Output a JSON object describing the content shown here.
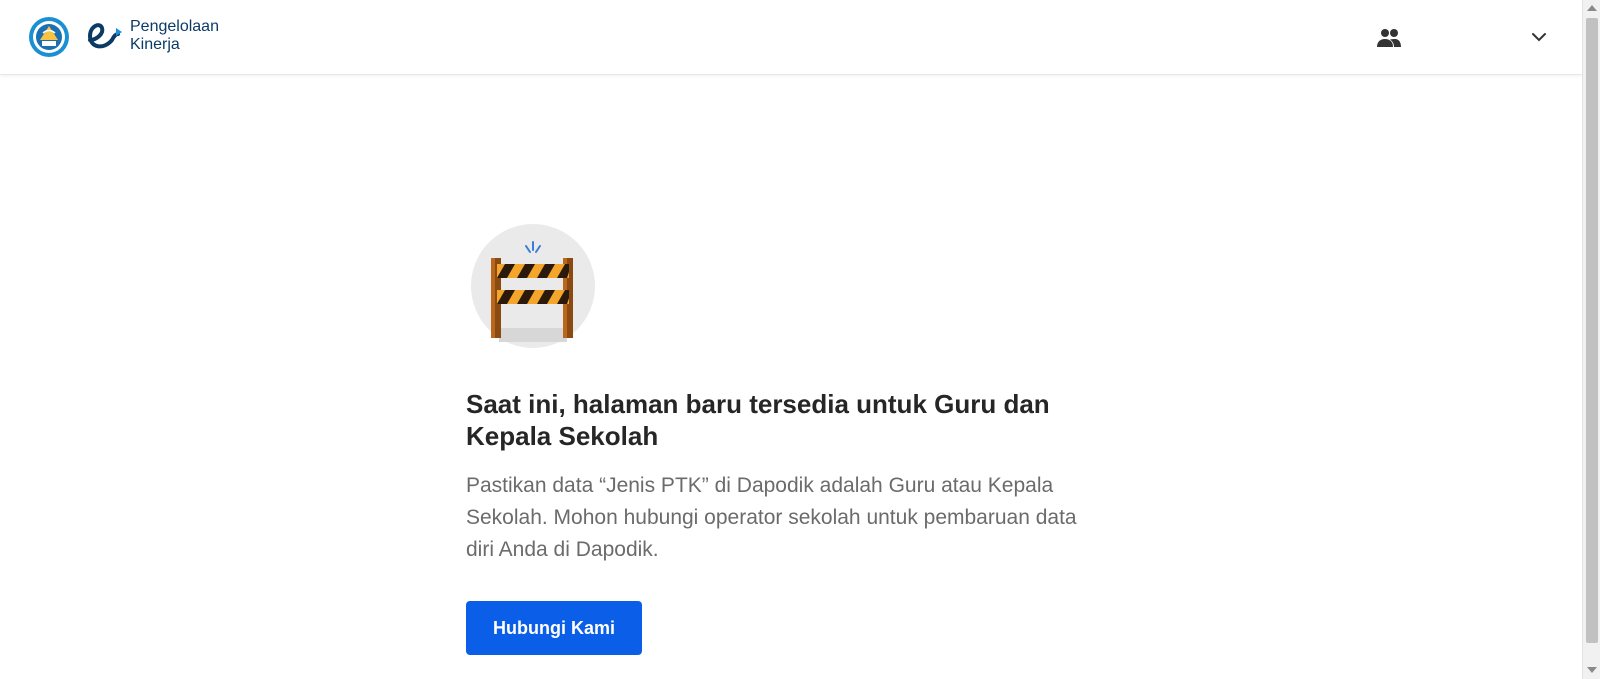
{
  "header": {
    "app_name_line1": "Pengelolaan",
    "app_name_line2": "Kinerja",
    "icons": {
      "gov_logo": "tut-wuri-handayani-logo",
      "app_logo": "pengelolaan-kinerja-logo",
      "profile": "people-icon",
      "menu": "chevron-down-icon"
    }
  },
  "main": {
    "illustration": "road-barrier-illustration",
    "title": "Saat ini, halaman baru tersedia untuk Guru dan Kepala Sekolah",
    "description": "Pastikan data “Jenis PTK” di Dapodik adalah Guru atau Kepala Sekolah. Mohon hubungi operator sekolah untuk pembaruan data diri Anda di Dapodik.",
    "button_label": "Hubungi Kami"
  },
  "colors": {
    "primary_button": "#0b5ee8",
    "title_text": "#262626",
    "body_text": "#6b6b6b",
    "brand_navy": "#0b3a67"
  }
}
